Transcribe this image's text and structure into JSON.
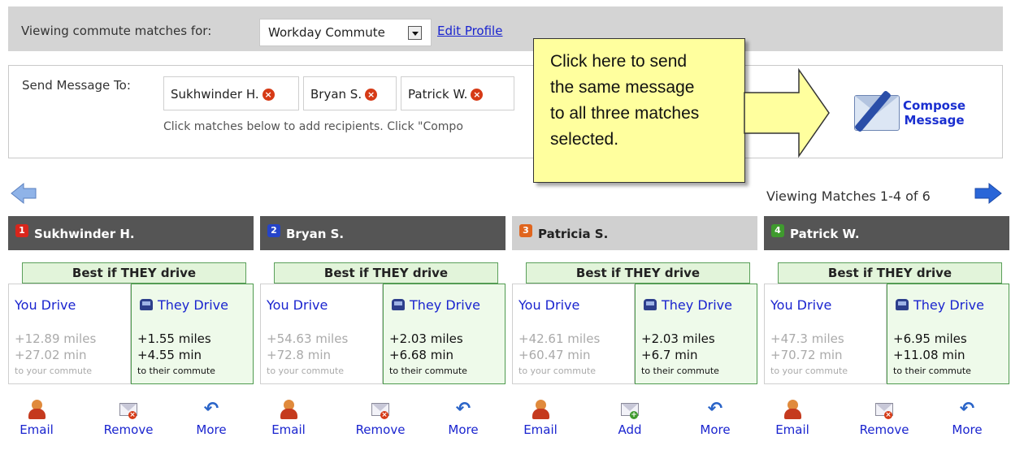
{
  "topbar": {
    "label": "Viewing commute matches for:",
    "profile_select": "Workday Commute",
    "edit_link": "Edit Profile"
  },
  "message": {
    "label": "Send Message To:",
    "recipients": [
      "Sukhwinder H.",
      "Bryan S.",
      "Patrick W."
    ],
    "hint": "Click matches below to add recipients. Click \"Compo",
    "compose_line1": "Compose",
    "compose_line2": "Message"
  },
  "callout": {
    "line1": "Click here to send",
    "line2": "the same message",
    "line3": "to all three matches",
    "line4": "selected."
  },
  "nav": {
    "info": "Viewing Matches 1-4 of 6"
  },
  "matches": [
    {
      "num": "1",
      "name": "Sukhwinder H.",
      "best": "Best if THEY drive",
      "you_title": "You Drive",
      "you_miles": "+12.89 miles",
      "you_min": "+27.02 min",
      "you_note": "to your commute",
      "they_title": "They Drive",
      "they_miles": "+1.55 miles",
      "they_min": "+4.55 min",
      "they_note": "to their commute",
      "act1": "Email",
      "act2": "Remove",
      "act3": "More"
    },
    {
      "num": "2",
      "name": "Bryan S.",
      "best": "Best if THEY drive",
      "you_title": "You Drive",
      "you_miles": "+54.63 miles",
      "you_min": "+72.8 min",
      "you_note": "to your commute",
      "they_title": "They Drive",
      "they_miles": "+2.03 miles",
      "they_min": "+6.68 min",
      "they_note": "to their commute",
      "act1": "Email",
      "act2": "Remove",
      "act3": "More"
    },
    {
      "num": "3",
      "name": "Patricia S.",
      "best": "Best if THEY drive",
      "you_title": "You Drive",
      "you_miles": "+42.61 miles",
      "you_min": "+60.47 min",
      "you_note": "to your commute",
      "they_title": "They Drive",
      "they_miles": "+2.03 miles",
      "they_min": "+6.7 min",
      "they_note": "to their commute",
      "act1": "Email",
      "act2": "Add",
      "act3": "More"
    },
    {
      "num": "4",
      "name": "Patrick W.",
      "best": "Best if THEY drive",
      "you_title": "You Drive",
      "you_miles": "+47.3 miles",
      "you_min": "+70.72 min",
      "you_note": "to your commute",
      "they_title": "They Drive",
      "they_miles": "+6.95 miles",
      "they_min": "+11.08 min",
      "they_note": "to their commute",
      "act1": "Email",
      "act2": "Remove",
      "act3": "More"
    }
  ],
  "colors": {
    "badge1": "#d9261c",
    "badge2": "#2544c8",
    "badge3": "#e0651e",
    "badge4": "#3f9a2e",
    "link": "#1a24cf",
    "callout_bg": "#ffff9e",
    "best_bg": "#e2f4da"
  },
  "icons": {
    "remove_chip": "close-circle-icon",
    "compose": "envelope-pen-icon",
    "prev": "arrow-left-icon",
    "next": "arrow-right-icon",
    "email": "person-icon",
    "remove": "mail-remove-icon",
    "add": "mail-add-icon",
    "more": "more-arrow-icon",
    "car": "car-icon"
  }
}
